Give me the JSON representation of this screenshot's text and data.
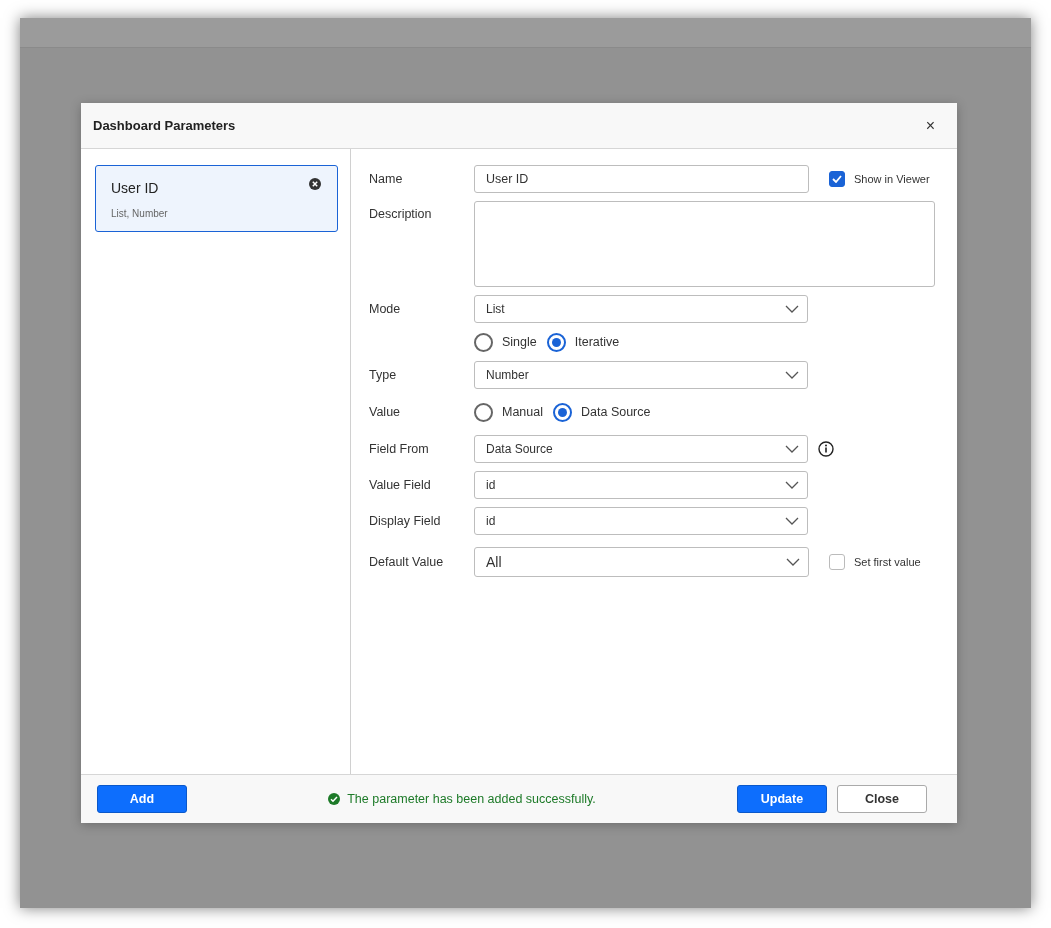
{
  "dialog": {
    "title": "Dashboard Parameters",
    "close": "×"
  },
  "parameters": [
    {
      "name": "User ID",
      "summary": "List, Number",
      "selected": true
    }
  ],
  "form": {
    "rows": [
      {
        "kind": "text",
        "label": "Name",
        "value": "User ID",
        "option": {
          "label": "Show in Viewer",
          "checked": true
        }
      },
      {
        "kind": "textarea",
        "label": "Description"
      },
      {
        "kind": "select",
        "label": "Mode",
        "value": "List"
      },
      {
        "kind": "radios",
        "options": [
          {
            "label": "Single",
            "selected": false
          },
          {
            "label": "Iterative",
            "selected": true
          }
        ]
      },
      {
        "kind": "select",
        "label": "Type",
        "value": "Number"
      },
      {
        "kind": "radios",
        "label": "Value",
        "options": [
          {
            "label": "Manual",
            "selected": false
          },
          {
            "label": "Data Source",
            "selected": true
          }
        ]
      },
      {
        "kind": "select",
        "label": "Field From",
        "value": "Data Source",
        "info": true
      },
      {
        "kind": "select",
        "label": "Value Field",
        "value": "id"
      },
      {
        "kind": "select",
        "label": "Display Field",
        "value": "id"
      },
      {
        "kind": "select",
        "label": "Default Value",
        "value": "All",
        "large": true,
        "option": {
          "label": "Set first value",
          "checked": false
        }
      }
    ]
  },
  "footer": {
    "add": "Add",
    "message": "The parameter has been added successfully.",
    "buttons": [
      {
        "label": "Update",
        "kind": "primary"
      },
      {
        "label": "Close",
        "kind": "secondary"
      }
    ]
  }
}
